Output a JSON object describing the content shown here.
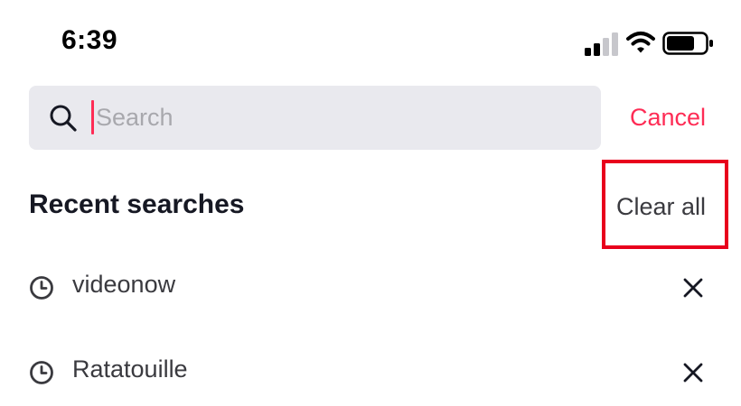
{
  "status_bar": {
    "time": "6:39",
    "signal_icon": "cellular-signal-icon",
    "wifi_icon": "wifi-icon",
    "battery_icon": "battery-icon"
  },
  "search": {
    "placeholder": "Search",
    "value": "",
    "icon": "search-icon",
    "cancel_label": "Cancel"
  },
  "recent": {
    "title": "Recent searches",
    "clear_label": "Clear all",
    "items": [
      {
        "label": "videonow",
        "icon": "clock-icon",
        "remove_icon": "close-icon"
      },
      {
        "label": "Ratatouille",
        "icon": "clock-icon",
        "remove_icon": "close-icon"
      }
    ]
  },
  "colors": {
    "accent": "#fe2c55",
    "search_bg": "#e9e9ee",
    "highlight": "#e8001c"
  }
}
